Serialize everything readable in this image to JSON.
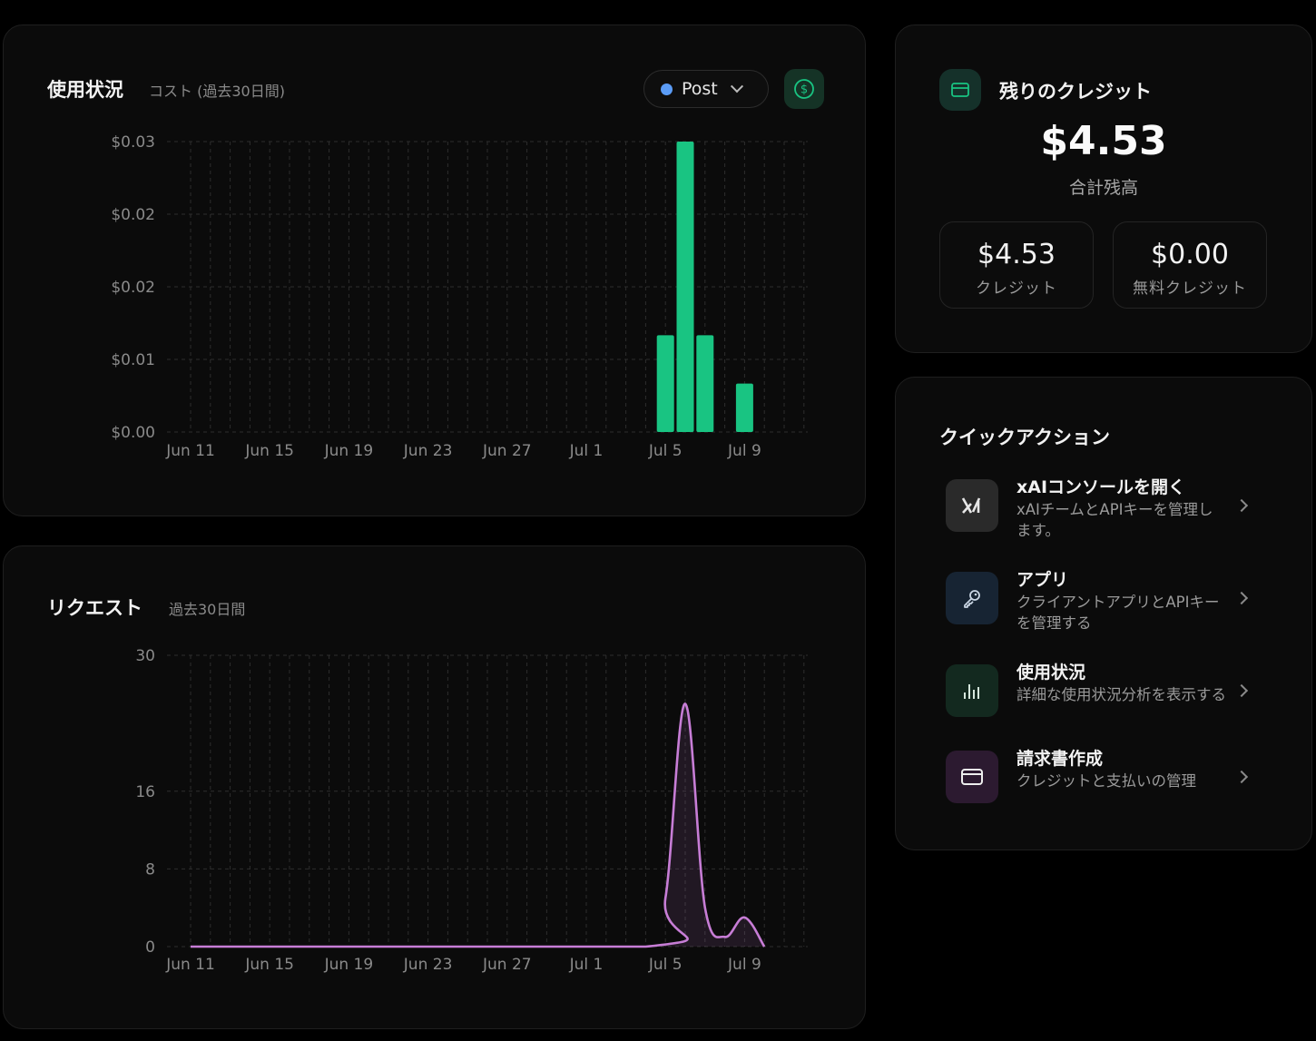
{
  "usage": {
    "title": "使用状況",
    "subtitle": "コスト (過去30日間)",
    "filter_label": "Post",
    "dollar_icon": "dollar-circle-icon"
  },
  "requests": {
    "title": "リクエスト",
    "subtitle": "過去30日間"
  },
  "credits": {
    "title": "残りのクレジット",
    "total_value": "$4.53",
    "total_label": "合計残高",
    "paid_value": "$4.53",
    "paid_label": "クレジット",
    "free_value": "$0.00",
    "free_label": "無料クレジット"
  },
  "quick_actions": {
    "title": "クイックアクション",
    "items": [
      {
        "title": "xAIコンソールを開く",
        "desc": "xAIチームとAPIキーを管理します。",
        "icon": "xai-logo-icon"
      },
      {
        "title": "アプリ",
        "desc": "クライアントアプリとAPIキーを管理する",
        "icon": "key-icon"
      },
      {
        "title": "使用状況",
        "desc": "詳細な使用状況分析を表示する",
        "icon": "bar-chart-icon"
      },
      {
        "title": "請求書作成",
        "desc": "クレジットと支払いの管理",
        "icon": "credit-card-icon"
      }
    ]
  },
  "colors": {
    "cost_bar": "#19c482",
    "requests_line": "#c77dd6",
    "filter_dot": "#5b9cf6"
  },
  "chart_data": [
    {
      "type": "bar",
      "x_labels": [
        "Jun 11",
        "Jun 15",
        "Jun 19",
        "Jun 23",
        "Jun 27",
        "Jul 1",
        "Jul 5",
        "Jul 9"
      ],
      "y_tick_labels": [
        "$0.00",
        "$0.01",
        "$0.02",
        "$0.02",
        "$0.03"
      ],
      "y_ticks": [
        0,
        0.0075,
        0.015,
        0.0225,
        0.03
      ],
      "ylim": [
        0,
        0.03
      ],
      "grid": true,
      "x": [
        "Jul 5",
        "Jul 6",
        "Jul 7",
        "Jul 9"
      ],
      "values": [
        0.01,
        0.03,
        0.01,
        0.005
      ]
    },
    {
      "type": "area",
      "x_labels": [
        "Jun 11",
        "Jun 15",
        "Jun 19",
        "Jun 23",
        "Jun 27",
        "Jul 1",
        "Jul 5",
        "Jul 9"
      ],
      "y_tick_labels": [
        "0",
        "8",
        "16",
        "30"
      ],
      "y_ticks": [
        0,
        8,
        16,
        30
      ],
      "ylim": [
        0,
        30
      ],
      "grid": true,
      "x": [
        "Jun 11",
        "Jul 4",
        "Jul 5",
        "Jul 6",
        "Jul 7",
        "Jul 8",
        "Jul 9",
        "Jul 10"
      ],
      "values": [
        0,
        0,
        5,
        25,
        4,
        1,
        3,
        0
      ]
    }
  ]
}
